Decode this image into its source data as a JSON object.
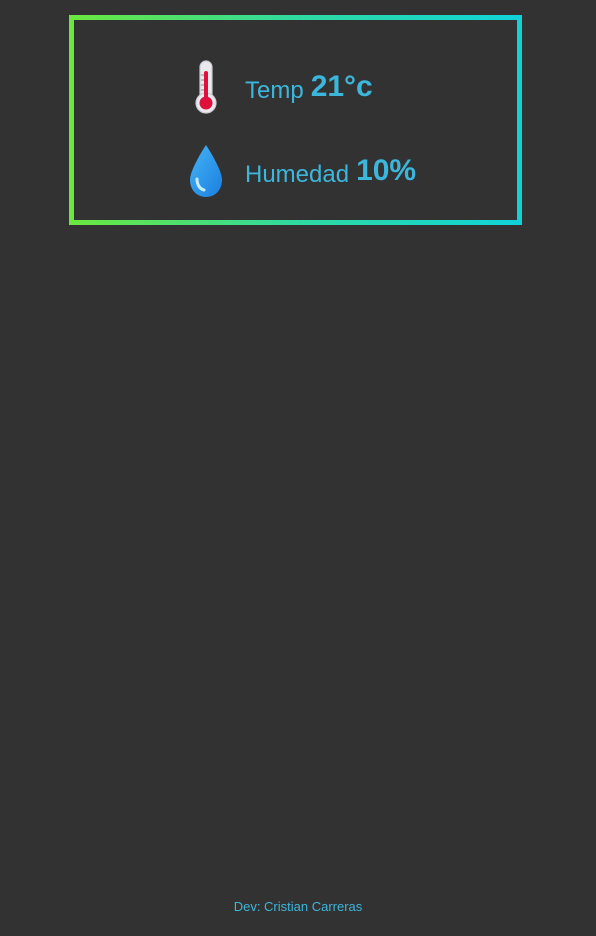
{
  "temperature": {
    "icon": "thermometer-icon",
    "label": "Temp",
    "value": "21°c"
  },
  "humidity": {
    "icon": "droplet-icon",
    "label": "Humedad",
    "value": "10%"
  },
  "footer": {
    "text": "Dev: Cristian Carreras"
  },
  "colors": {
    "background": "#323232",
    "text_accent": "#3db6dc",
    "border_gradient_start": "#6be83e",
    "border_gradient_end": "#10d3d8"
  }
}
